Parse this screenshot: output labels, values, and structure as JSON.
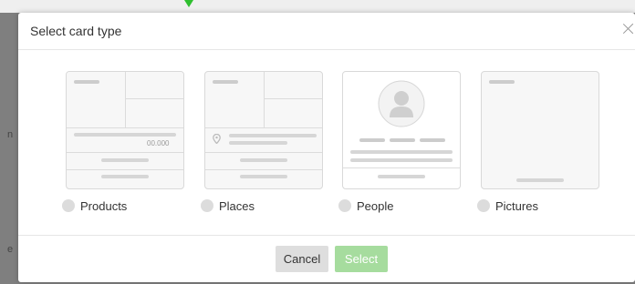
{
  "dialog": {
    "title": "Select card type",
    "close_icon": "close-icon"
  },
  "options": [
    {
      "label": "Products",
      "price": "00.000"
    },
    {
      "label": "Places"
    },
    {
      "label": "People"
    },
    {
      "label": "Pictures"
    }
  ],
  "footer": {
    "cancel_label": "Cancel",
    "select_label": "Select"
  },
  "background": {
    "frag_a": "n",
    "frag_b": "e"
  },
  "colors": {
    "select_button": "#a6dc9e",
    "arrow": "#2fbf2f"
  }
}
